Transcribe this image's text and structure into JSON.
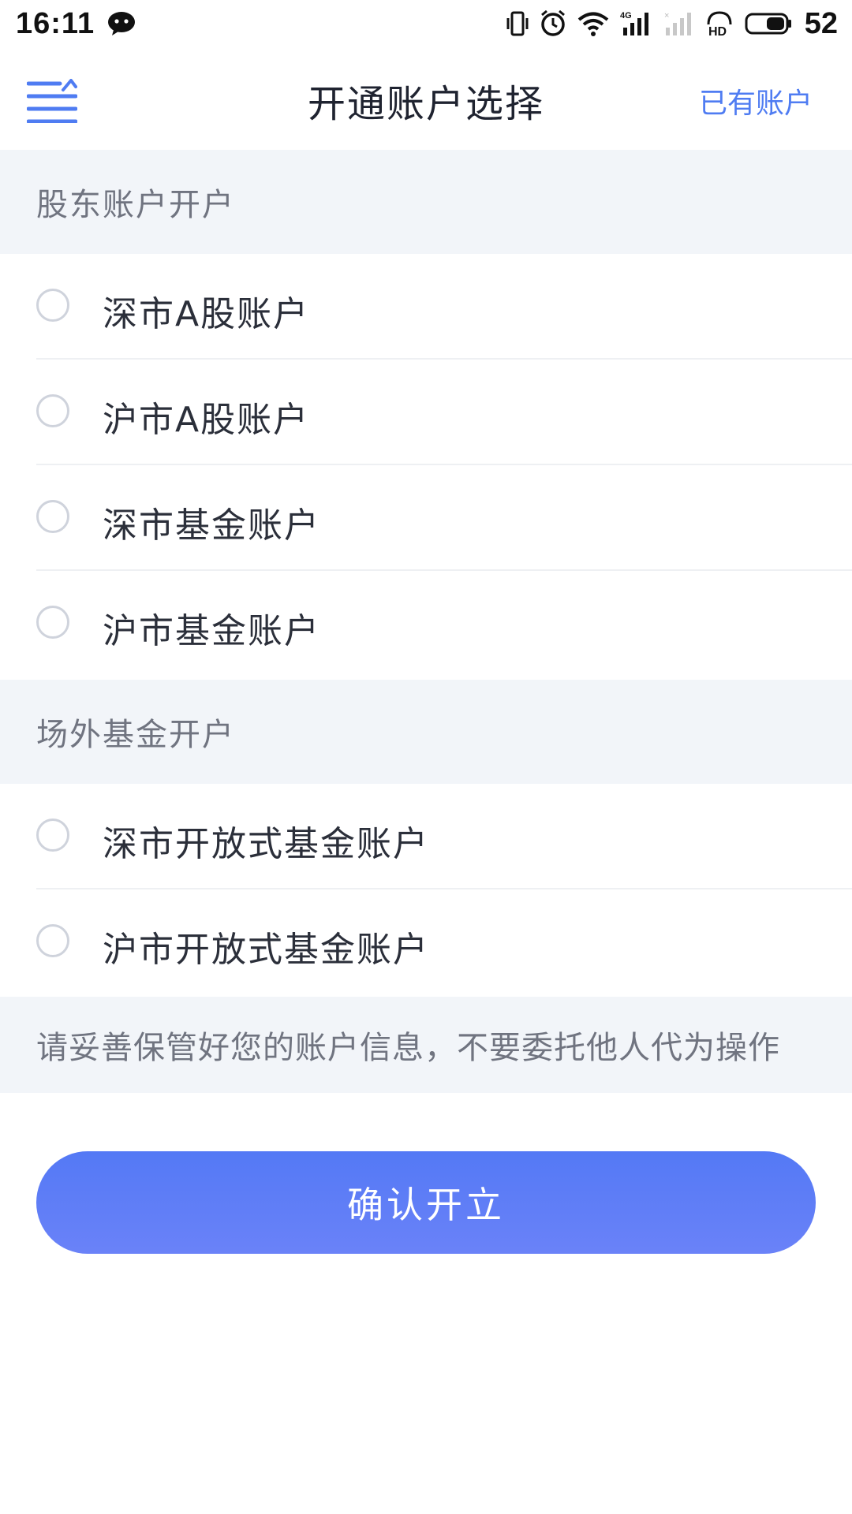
{
  "status_bar": {
    "time": "16:11",
    "battery": "52",
    "network": "4G",
    "hd": "HD"
  },
  "nav": {
    "title": "开通账户选择",
    "action_label": "已有账户",
    "accent_color": "#4f7cf2"
  },
  "sections": [
    {
      "header": "股东账户开户",
      "options": [
        {
          "label": "深市A股账户",
          "selected": false
        },
        {
          "label": "沪市A股账户",
          "selected": false
        },
        {
          "label": "深市基金账户",
          "selected": false
        },
        {
          "label": "沪市基金账户",
          "selected": false
        }
      ]
    },
    {
      "header": "场外基金开户",
      "options": [
        {
          "label": "深市开放式基金账户",
          "selected": false
        },
        {
          "label": "沪市开放式基金账户",
          "selected": false
        }
      ]
    }
  ],
  "notice": "请妥善保管好您的账户信息，不要委托他人代为操作",
  "confirm_button": {
    "label": "确认开立",
    "color": "#5a7cf6"
  },
  "icons": {
    "menu": "menu-back-icon",
    "chat": "chat-bubble-icon",
    "vibrate": "vibrate-icon",
    "alarm": "alarm-icon",
    "wifi": "wifi-icon",
    "signal": "cellular-signal-icon",
    "battery": "battery-icon"
  }
}
